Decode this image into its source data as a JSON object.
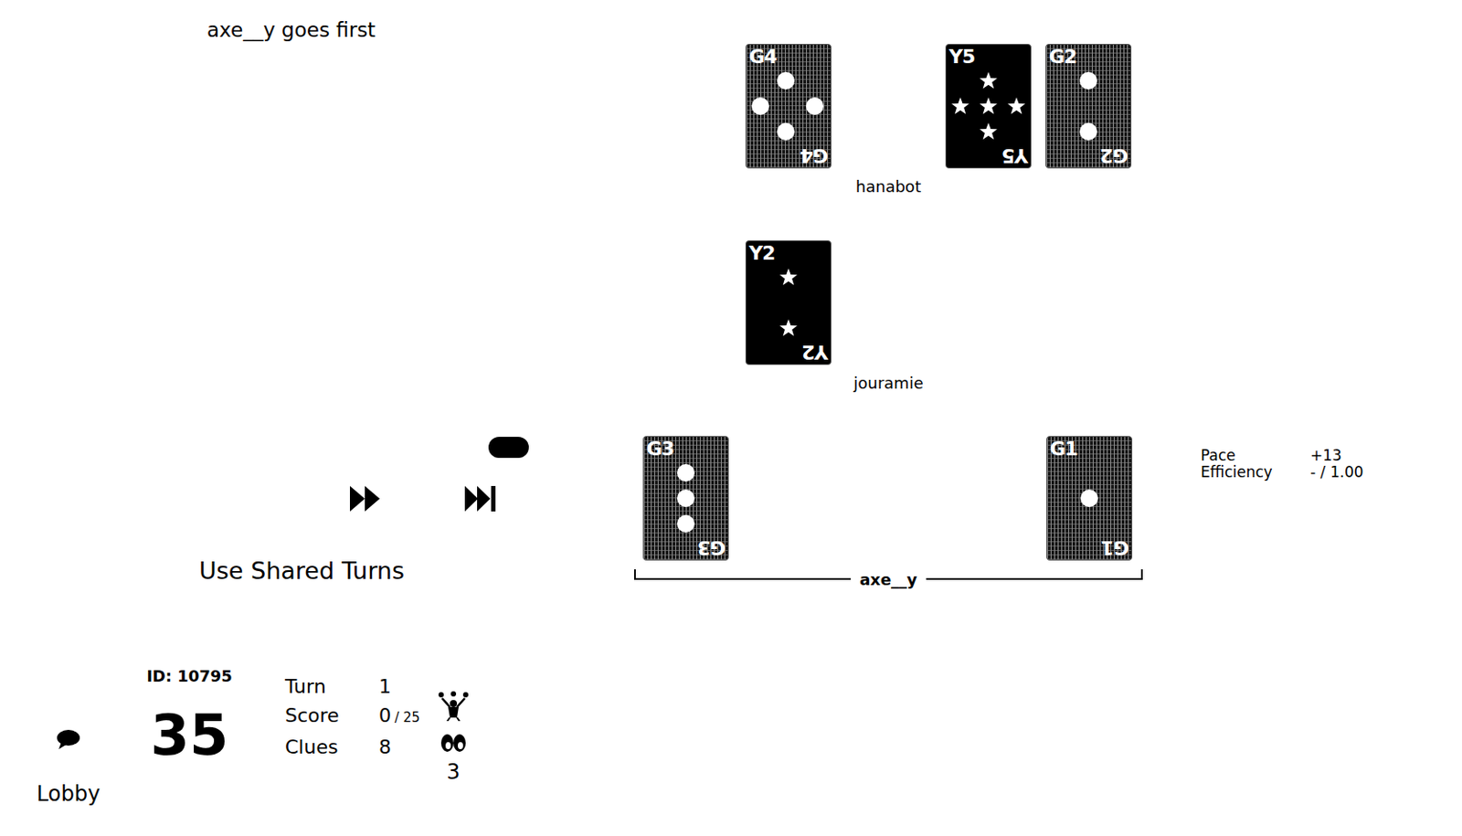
{
  "announcement": "axe__y goes first",
  "hands": [
    {
      "player": "hanabot",
      "current": false,
      "slots": [
        {
          "empty": false,
          "label": "G4",
          "kind": "green",
          "pips": 4
        },
        {
          "empty": true
        },
        {
          "empty": false,
          "label": "Y5",
          "kind": "yellow",
          "pips": 5
        },
        {
          "empty": false,
          "label": "G2",
          "kind": "green",
          "pips": 2
        }
      ]
    },
    {
      "player": "jouramie",
      "current": false,
      "slots": [
        {
          "empty": false,
          "label": "Y2",
          "kind": "yellow",
          "pips": 2
        },
        {
          "empty": true
        },
        {
          "empty": true
        },
        {
          "empty": true
        }
      ]
    },
    {
      "player": "axe__y",
      "current": true,
      "slots": [
        {
          "empty": false,
          "label": "G3",
          "kind": "green",
          "pips": 3
        },
        {
          "empty": true
        },
        {
          "empty": true
        },
        {
          "empty": true
        },
        {
          "empty": false,
          "label": "G1",
          "kind": "green",
          "pips": 1
        }
      ]
    }
  ],
  "stats": [
    {
      "label": "Pace",
      "value": "+13"
    },
    {
      "label": "Efficiency",
      "value": "- / 1.00"
    }
  ],
  "controls": {
    "shared_turns": "Use Shared Turns"
  },
  "game": {
    "id_label": "ID: 10795",
    "timer": "35",
    "rows": [
      {
        "label": "Turn",
        "value": "1",
        "suffix": ""
      },
      {
        "label": "Score",
        "value": "0",
        "suffix": "/ 25"
      },
      {
        "label": "Clues",
        "value": "8",
        "suffix": ""
      }
    ],
    "spectators": "3"
  },
  "lobby": "Lobby"
}
